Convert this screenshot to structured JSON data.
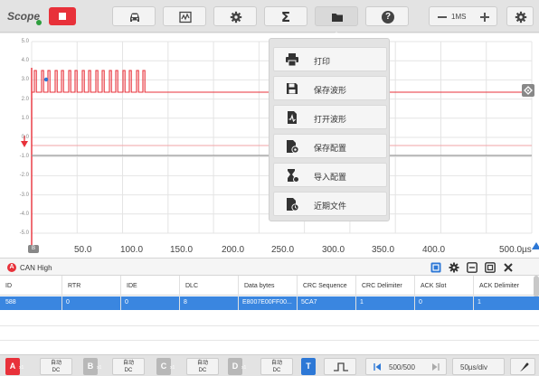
{
  "app": {
    "title": "Scope"
  },
  "toolbar": {
    "buttons": [
      {
        "name": "car-icon"
      },
      {
        "name": "waveform-library-icon"
      },
      {
        "name": "gear-icon"
      },
      {
        "name": "sigma-icon",
        "label": "Σ"
      },
      {
        "name": "folder-icon"
      },
      {
        "name": "help-icon",
        "label": "?"
      }
    ],
    "zoom_label": "1MS"
  },
  "graph": {
    "y_ticks": [
      "5.0",
      "4.0",
      "3.0",
      "2.0",
      "1.0",
      "0.0",
      "-1.0",
      "-2.0",
      "-3.0",
      "-4.0",
      "-5.0"
    ],
    "x_ticks": [
      "50.0",
      "100.0",
      "150.0",
      "200.0",
      "250.0",
      "300.0",
      "350.0",
      "400.0",
      "500.0µs"
    ],
    "x0_marker": "B",
    "colors": {
      "trace": "#e8313a",
      "cursor": "#2d78d6",
      "grid": "#e4e4e4"
    }
  },
  "menu": {
    "items": [
      {
        "icon": "printer-icon",
        "label": "打印"
      },
      {
        "icon": "save-waveform-icon",
        "label": "保存波形"
      },
      {
        "icon": "open-waveform-icon",
        "label": "打开波形"
      },
      {
        "icon": "save-config-icon",
        "label": "保存配置"
      },
      {
        "icon": "import-config-icon",
        "label": "导入配置"
      },
      {
        "icon": "recent-files-icon",
        "label": "近期文件"
      }
    ]
  },
  "channel": {
    "badge": "A",
    "label": "CAN High"
  },
  "table": {
    "columns": [
      "ID",
      "RTR",
      "IDE",
      "DLC",
      "Data bytes",
      "CRC Sequence",
      "CRC Delimiter",
      "ACK Slot",
      "ACK Delimiter"
    ],
    "rows": [
      [
        "588",
        "0",
        "0",
        "8",
        "E8007E00FF00...",
        "5CA7",
        "1",
        "0",
        "1"
      ]
    ]
  },
  "bottom_bar": {
    "channels": [
      {
        "letter": "A",
        "sub": "x1",
        "coupling_top": "自动",
        "coupling_bottom": "DC",
        "color": "#e8313a"
      },
      {
        "letter": "B",
        "sub": "x1",
        "coupling_top": "自动",
        "coupling_bottom": "DC",
        "color": "#b8b8b8"
      },
      {
        "letter": "C",
        "sub": "x1",
        "coupling_top": "自动",
        "coupling_bottom": "DC",
        "color": "#b8b8b8"
      },
      {
        "letter": "D",
        "sub": "x1",
        "coupling_top": "自动",
        "coupling_bottom": "DC",
        "color": "#b8b8b8"
      }
    ],
    "trigger_label": "T",
    "page_text": "500/500",
    "timebase": "50µs/div"
  }
}
